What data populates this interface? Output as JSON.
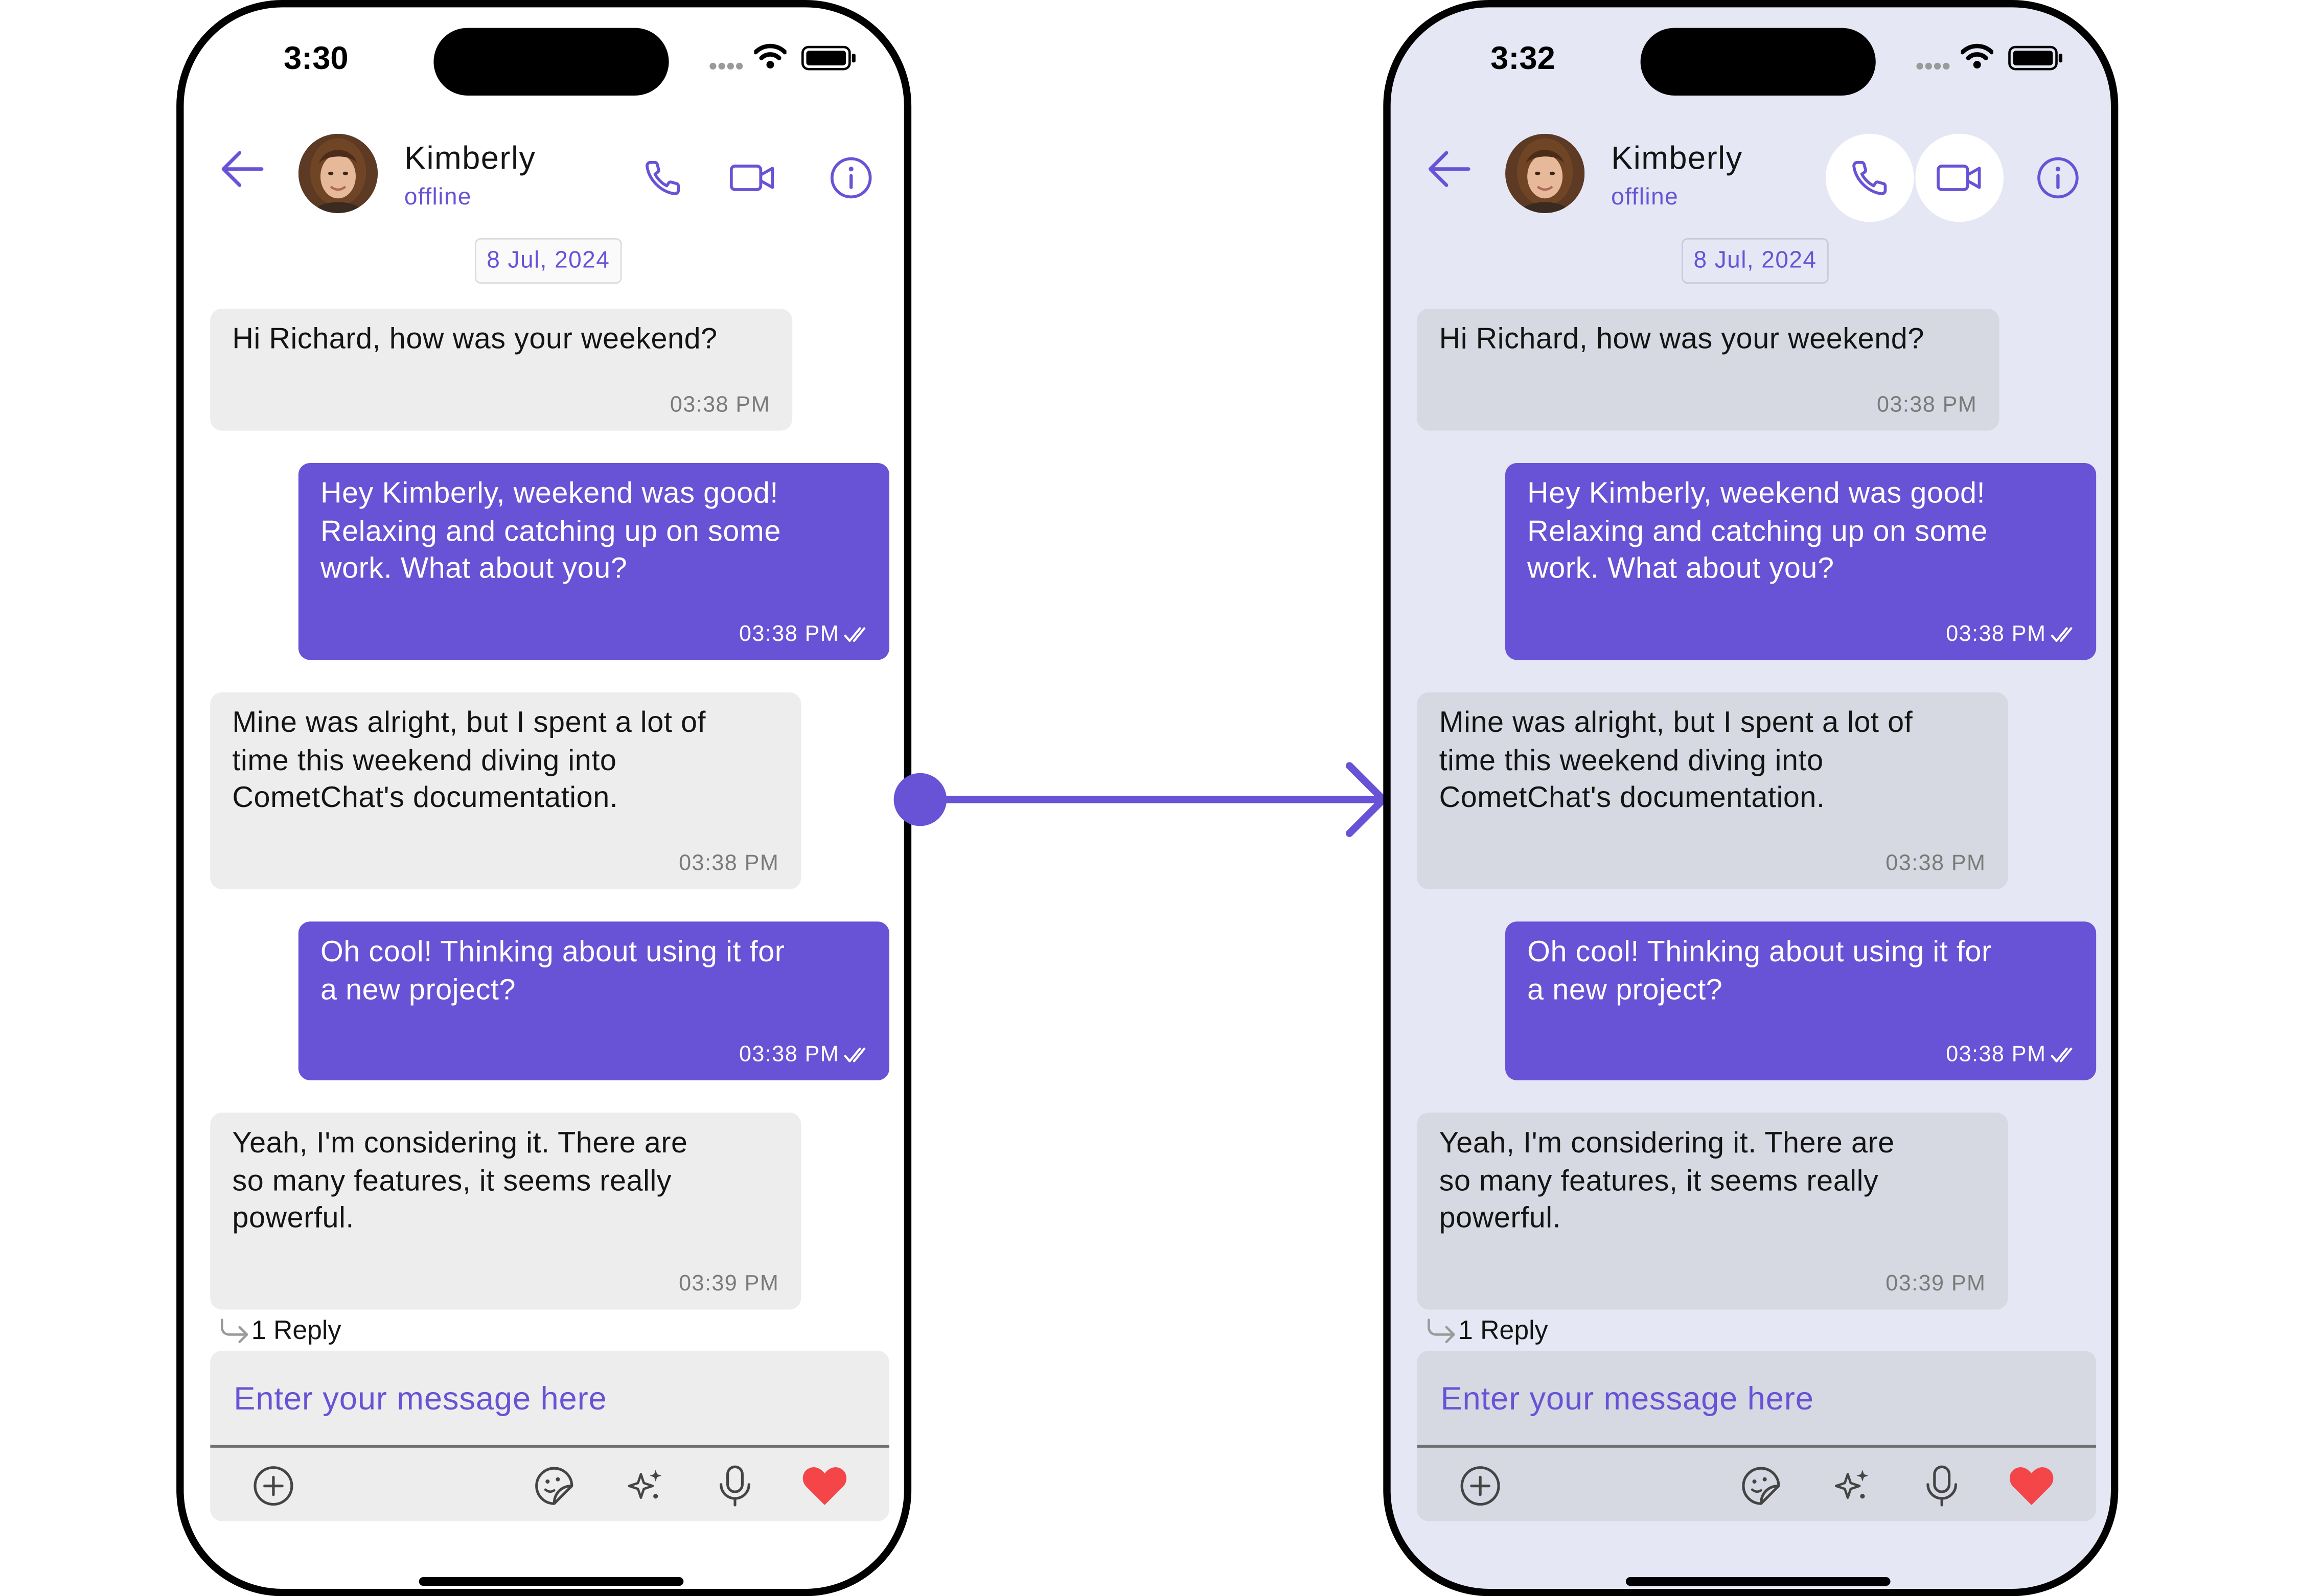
{
  "colors": {
    "accent": "#6852d6",
    "heart": "#f44649",
    "left_bg": "#ffffff",
    "right_bg": "#e5e8f4"
  },
  "left": {
    "time": "3:30",
    "header": {
      "name": "Kimberly",
      "status": "offline"
    },
    "date_separator": "8 Jul, 2024",
    "messages": [
      {
        "direction": "incoming",
        "text": "Hi Richard, how was your weekend?",
        "time": "03:38 PM"
      },
      {
        "direction": "outgoing",
        "text": "Hey Kimberly, weekend was good!\nRelaxing and catching up on some\nwork.  What about you?",
        "time": "03:38 PM"
      },
      {
        "direction": "incoming",
        "text": "Mine was alright, but I spent a lot of\ntime this weekend diving into\nCometChat's documentation.",
        "time": "03:38 PM"
      },
      {
        "direction": "outgoing",
        "text": "Oh cool! Thinking about using it for\na new project?",
        "time": "03:38 PM"
      },
      {
        "direction": "incoming",
        "text": "Yeah, I'm considering it.  There are\nso many features, it seems really\npowerful.",
        "time": "03:39 PM"
      }
    ],
    "reply_label": "1 Reply",
    "composer": {
      "placeholder": "Enter your message here"
    }
  },
  "right": {
    "time": "3:32",
    "header": {
      "name": "Kimberly",
      "status": "offline"
    },
    "date_separator": "8 Jul, 2024",
    "messages": [
      {
        "direction": "incoming",
        "text": "Hi Richard, how was your weekend?",
        "time": "03:38 PM"
      },
      {
        "direction": "outgoing",
        "text": "Hey Kimberly, weekend was good!\nRelaxing and catching up on some\nwork.  What about you?",
        "time": "03:38 PM"
      },
      {
        "direction": "incoming",
        "text": "Mine was alright, but I spent a lot of\ntime this weekend diving into\nCometChat's documentation.",
        "time": "03:38 PM"
      },
      {
        "direction": "outgoing",
        "text": "Oh cool! Thinking about using it for\na new project?",
        "time": "03:38 PM"
      },
      {
        "direction": "incoming",
        "text": "Yeah, I'm considering it.  There are\nso many features, it seems really\npowerful.",
        "time": "03:39 PM"
      }
    ],
    "reply_label": "1 Reply",
    "composer": {
      "placeholder": "Enter your message here"
    }
  }
}
